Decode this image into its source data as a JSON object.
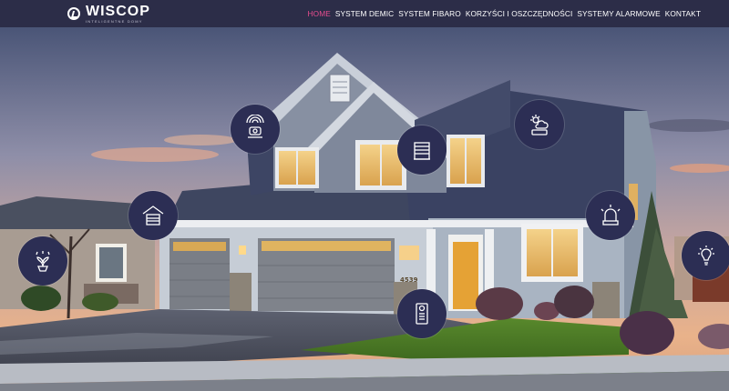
{
  "brand": {
    "name": "WISCOP",
    "tagline": "INTELIGENTNE DOMY"
  },
  "nav": {
    "items": [
      {
        "label": "HOME",
        "active": true
      },
      {
        "label": "SYSTEM DEMIC",
        "active": false
      },
      {
        "label": "SYSTEM FIBARO",
        "active": false
      },
      {
        "label": "KORZYŚCI I OSZCZĘDNOŚCI",
        "active": false
      },
      {
        "label": "SYSTEMY ALARMOWE",
        "active": false
      },
      {
        "label": "KONTAKT",
        "active": false
      }
    ]
  },
  "house": {
    "number_plate": "4539"
  },
  "features": [
    {
      "icon": "security-camera-icon"
    },
    {
      "icon": "weather-station-icon"
    },
    {
      "icon": "radiator-icon"
    },
    {
      "icon": "garage-door-icon"
    },
    {
      "icon": "alarm-siren-icon"
    },
    {
      "icon": "garden-irrigation-icon"
    },
    {
      "icon": "smart-bulb-icon"
    },
    {
      "icon": "video-intercom-icon"
    }
  ],
  "colors": {
    "navbar": "#2c2d48",
    "accent": "#e64d8e",
    "icon_circle": "#2c2e54"
  }
}
